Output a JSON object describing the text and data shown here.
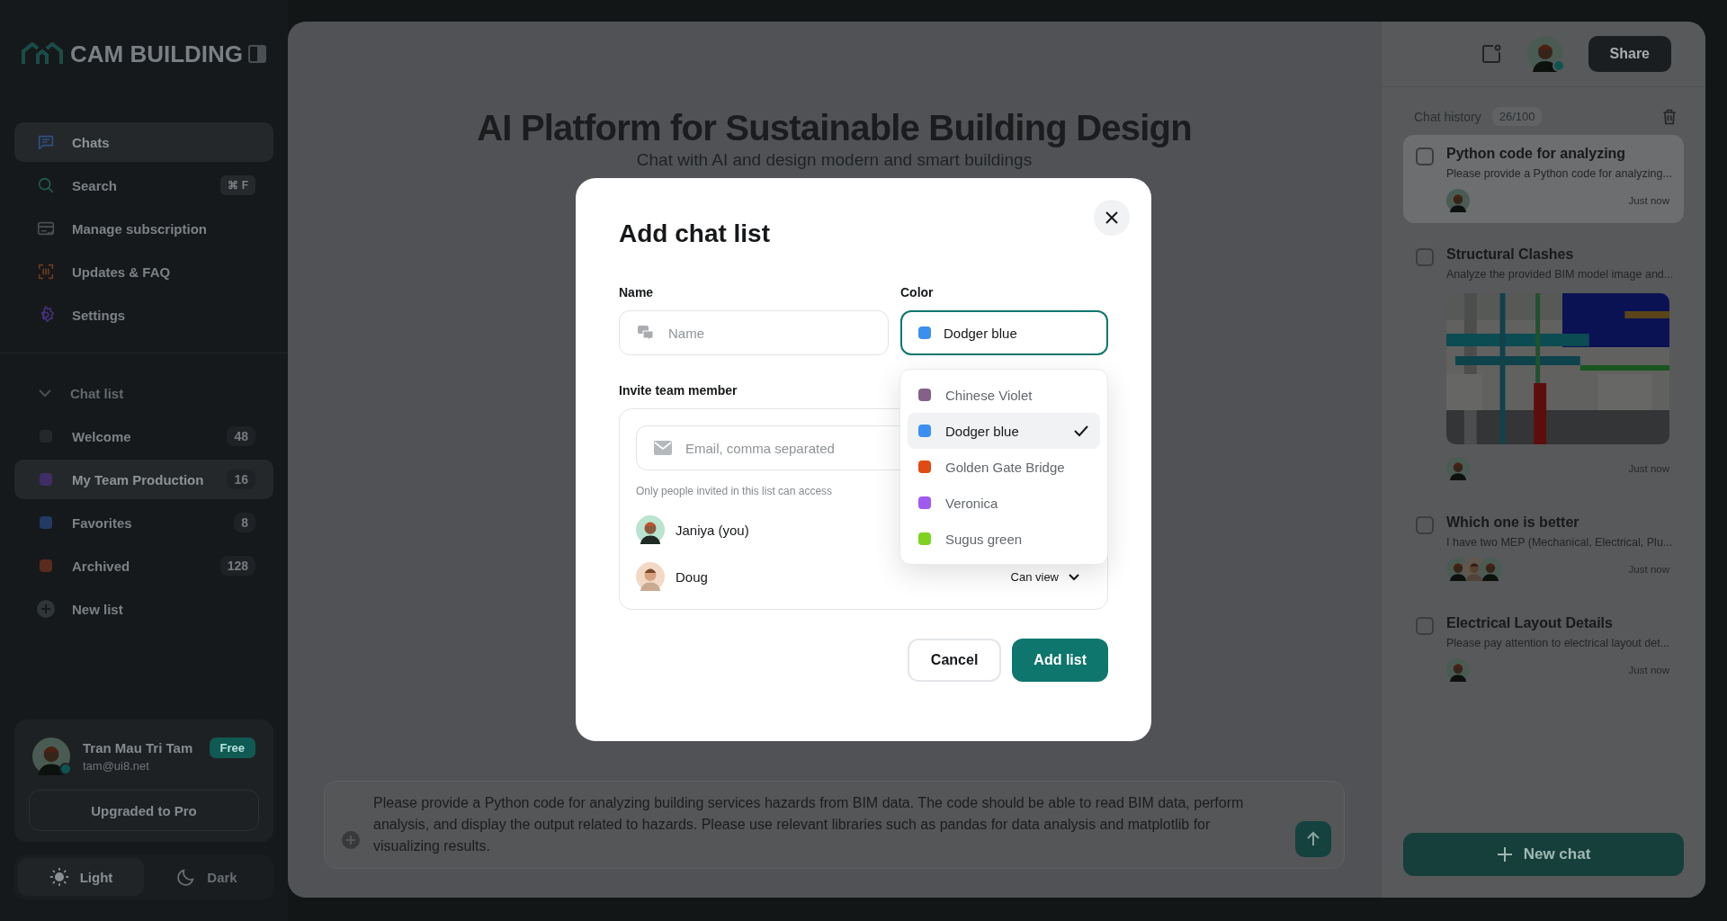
{
  "sidebar": {
    "logo": "CAM BUILDING",
    "nav": [
      {
        "label": "Chats",
        "selected": true
      },
      {
        "label": "Search",
        "selected": false,
        "shortcut": "⌘ F"
      },
      {
        "label": "Manage subscription",
        "selected": false
      },
      {
        "label": "Updates & FAQ",
        "selected": false
      },
      {
        "label": "Settings",
        "selected": false
      }
    ],
    "chat_list_label": "Chat list",
    "lists": [
      {
        "label": "Welcome",
        "count": "48",
        "color": "#24282b",
        "selected": false
      },
      {
        "label": "My Team Production",
        "count": "16",
        "color": "#3f2d66",
        "selected": true
      },
      {
        "label": "Favorites",
        "count": "8",
        "color": "#233a63",
        "selected": false
      },
      {
        "label": "Archived",
        "count": "128",
        "color": "#5a2a1c",
        "selected": false
      }
    ],
    "new_list": "New list",
    "profile": {
      "name": "Tran Mau Tri Tam",
      "email": "tam@ui8.net",
      "badge": "Free",
      "upgrade": "Upgraded to Pro"
    },
    "theme": [
      {
        "label": "Light",
        "selected": true
      },
      {
        "label": "Dark",
        "selected": false
      }
    ]
  },
  "main": {
    "title": "AI Platform for Sustainable Building Design",
    "subtitle": "Chat with AI and design modern and smart buildings",
    "prompt": "Please provide a Python code for analyzing building services hazards from BIM data. The code should be able to read BIM data, perform analysis, and display the output related to hazards. Please use relevant libraries such as pandas for data analysis and matplotlib for visualizing results."
  },
  "right_panel": {
    "share": "Share",
    "history_label": "Chat history",
    "history_count": "26/100",
    "chats": [
      {
        "title": "Python code for analyzing",
        "preview": "Please provide a Python code for analyzing...",
        "time": "Just now",
        "selected": true,
        "checked": false,
        "avatars": [
          {
            "kind": "man"
          }
        ]
      },
      {
        "title": "Structural Clashes",
        "preview": "Analyze the provided BIM model image and...",
        "time": "Just now",
        "selected": false,
        "checked": false,
        "picture": {
          "kind": "picture"
        },
        "avatars": [
          {
            "kind": "man"
          }
        ]
      },
      {
        "title": "Which one is better",
        "preview": "I have two MEP (Mechanical, Electrical, Plu...",
        "time": "Just now",
        "selected": false,
        "checked": false,
        "avatars": [
          {
            "kind": "man"
          },
          {
            "kind": "woman"
          },
          {
            "kind": "man"
          }
        ]
      },
      {
        "title": "Electrical Layout Details",
        "preview": "Please pay attention to electrical layout det...",
        "time": "Just now",
        "selected": false,
        "checked": false,
        "avatars": [
          {
            "kind": "man"
          }
        ]
      }
    ],
    "new_chat": "New chat"
  },
  "modal": {
    "title": "Add chat list",
    "name_label": "Name",
    "name_placeholder": "Name",
    "color_label": "Color",
    "color_select": {
      "value": "Dodger blue",
      "color": "#3b8ff0"
    },
    "color_options": [
      {
        "label": "Chinese Violet",
        "color": "#856088",
        "selected": false
      },
      {
        "label": "Dodger blue",
        "color": "#3b8ff0",
        "selected": true
      },
      {
        "label": "Golden Gate Bridge",
        "color": "#df4b12",
        "selected": false
      },
      {
        "label": "Veronica",
        "color": "#9f5af0",
        "selected": false
      },
      {
        "label": "Sugus green",
        "color": "#7ed321",
        "selected": false
      }
    ],
    "invite_label": "Invite team member",
    "email_placeholder": "Email, comma separated",
    "note": "Only people invited in this list can access",
    "members": [
      {
        "name": "Janiya (you)",
        "kind": "man"
      },
      {
        "name": "Doug",
        "kind": "woman",
        "role": "Can view"
      }
    ],
    "cancel": "Cancel",
    "submit": "Add list"
  }
}
